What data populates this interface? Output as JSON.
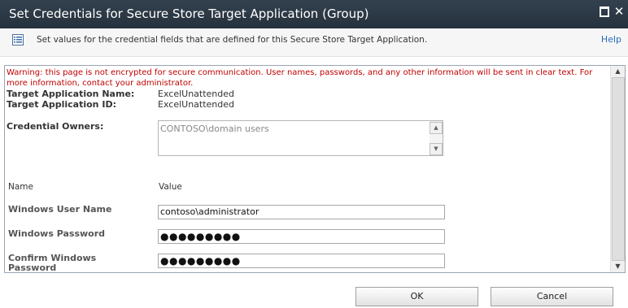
{
  "dialog": {
    "title": "Set Credentials for Secure Store Target Application (Group)",
    "description": "Set values for the credential fields that are defined for this Secure Store Target Application.",
    "help_label": "Help"
  },
  "warning": "Warning: this page is not encrypted for secure communication. User names, passwords, and any other information will be sent in clear text. For more information, contact your administrator.",
  "target_app": {
    "name_label": "Target Application Name:",
    "name_value": "ExcelUnattended",
    "id_label": "Target Application ID:",
    "id_value": "ExcelUnattended"
  },
  "credential_owners": {
    "label": "Credential Owners:",
    "value": "CONTOSO\\domain users"
  },
  "fields_header": {
    "name": "Name",
    "value": "Value"
  },
  "fields": {
    "windows_user_name": {
      "label": "Windows User Name",
      "value": "contoso\\administrator"
    },
    "windows_password": {
      "label": "Windows Password",
      "value": "●●●●●●●●●"
    },
    "confirm_windows_password": {
      "label": "Confirm Windows Password",
      "value": "●●●●●●●●●"
    }
  },
  "buttons": {
    "ok": "OK",
    "cancel": "Cancel"
  },
  "colors": {
    "titlebar": "#2c3945",
    "warning": "#c00000",
    "link": "#2a6bb5"
  },
  "icons": [
    "maximize-icon",
    "close-icon",
    "list-description-icon",
    "scroll-up-icon",
    "scroll-down-icon"
  ]
}
